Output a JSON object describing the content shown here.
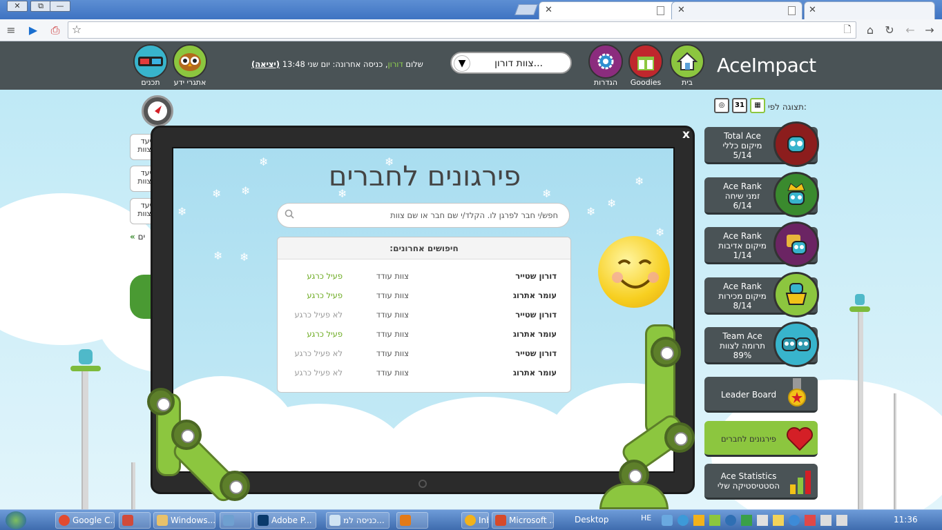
{
  "browser": {
    "window_controls": {
      "close": "✕",
      "restore": "⧉",
      "minimize": "—"
    },
    "tabs": [
      {
        "close": "✕"
      },
      {
        "close": "✕"
      },
      {
        "close": "✕"
      }
    ],
    "icons": {
      "menu": "≡",
      "cast": "▶",
      "pdf": "⎙",
      "star": "☆",
      "page": "🗋",
      "home": "⌂",
      "reload": "↻",
      "back": "←",
      "forward": "→"
    }
  },
  "header": {
    "logo": "AceImpact",
    "nav": [
      {
        "label": "בית",
        "icon": "house-icon",
        "color": "#8cc63f"
      },
      {
        "label": "Goodies",
        "icon": "gift-icon",
        "color": "#c0272d"
      },
      {
        "label": "הגדרות",
        "icon": "gear-icon",
        "color": "#8b2c7e"
      }
    ],
    "team_select": "צוות דורון...",
    "greeting_prefix": "שלום",
    "greeting_name": "דורון",
    "greeting_suffix": ", כניסה אחרונה: יום שני 13:48",
    "logout": "(יציאה)",
    "right_icons": [
      {
        "label": "אתגרי ידע",
        "icon": "owl-icon"
      },
      {
        "label": "תכנים",
        "icon": "3d-glasses-icon"
      }
    ]
  },
  "view_by": {
    "label": "תצוגה לפי:",
    "cal_day": "31"
  },
  "side_cards": [
    "יעד\nצוות",
    "יעד\nצוות",
    "יעד\nצוות"
  ],
  "side_more": "« ים",
  "tiles": [
    {
      "lines": [
        "Total Ace",
        "מיקום כללי",
        "5/14"
      ],
      "color": "#8c1d1d",
      "icon": "laurel-badge-icon"
    },
    {
      "lines": [
        "Ace Rank",
        "זמני שיחה",
        "6/14"
      ],
      "color": "#3a8a2e",
      "icon": "crown-robot-icon"
    },
    {
      "lines": [
        "Ace Rank",
        "מיקום אדיבות",
        "1/14"
      ],
      "color": "#6b2463",
      "icon": "trophy-robot-icon"
    },
    {
      "lines": [
        "Ace Rank",
        "מיקום מכירות",
        "8/14"
      ],
      "color": "#8cc63f",
      "icon": "basket-robot-icon"
    },
    {
      "lines": [
        "Team Ace",
        "תרומה לצוות",
        "89%"
      ],
      "color": "#38b4cc",
      "icon": "team-robots-icon"
    }
  ],
  "leader_board": "Leader Board",
  "compliments_tile": "פירגונים לחברים",
  "stats_tile": [
    "Ace Statistics",
    "הסטטיסטיקה שלי"
  ],
  "modal": {
    "close": "x",
    "title": "פירגונים לחברים",
    "search_placeholder": "חפש/י חבר לפרגן לו. הקלד/י שם חבר או שם צוות",
    "recent_header": "חיפושים אחרונים:",
    "rows": [
      {
        "name": "דורון שטייר",
        "team": "צוות עודד",
        "status": "פעיל כרגע",
        "active": true
      },
      {
        "name": "עומר אתרוג",
        "team": "צוות עודד",
        "status": "פעיל כרגע",
        "active": true
      },
      {
        "name": "דורון שטייר",
        "team": "צוות עודד",
        "status": "לא פעיל כרגע",
        "active": false
      },
      {
        "name": "עומר אתרוג",
        "team": "צוות עודד",
        "status": "פעיל כרגע",
        "active": true
      },
      {
        "name": "דורון שטייר",
        "team": "צוות עודד",
        "status": "לא פעיל כרגע",
        "active": false
      },
      {
        "name": "עומר אתרוג",
        "team": "צוות עודד",
        "status": "לא פעיל כרגע",
        "active": false
      }
    ]
  },
  "taskbar": {
    "items": [
      {
        "label": "Google C...",
        "color": "#e24b2f"
      },
      {
        "label": "",
        "color": "#d14a3a"
      },
      {
        "label": "Windows...",
        "color": "#e8c16a"
      },
      {
        "label": "",
        "color": "#6fa0d0"
      },
      {
        "label": "Adobe P...",
        "color": "#0a3a6c"
      },
      {
        "label": "כניסה למ...",
        "color": "#d0e4f3"
      },
      {
        "label": "",
        "color": "#e37a18"
      },
      {
        "label": "Inb",
        "color": "#f2b21b"
      },
      {
        "label": "Microsoft ...",
        "color": "#d64a2b"
      }
    ],
    "desktop": "Desktop",
    "lang": "HE",
    "time": "11:36"
  }
}
